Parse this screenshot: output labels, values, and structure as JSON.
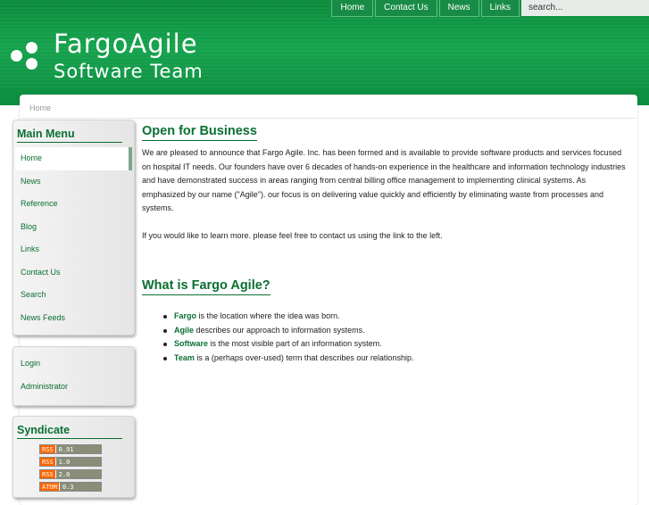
{
  "topnav": {
    "items": [
      "Home",
      "Contact Us",
      "News",
      "Links"
    ],
    "search_placeholder": "search..."
  },
  "site": {
    "title": "FargoAgile",
    "subtitle": "Software Team"
  },
  "breadcrumb": "Home",
  "main_menu": {
    "title": "Main Menu",
    "items": [
      "Home",
      "News",
      "Reference",
      "Blog",
      "Links",
      "Contact Us",
      "Search",
      "News Feeds"
    ]
  },
  "user_menu": {
    "items": [
      "Login",
      "Administrator"
    ]
  },
  "syndicate": {
    "title": "Syndicate",
    "feeds": [
      {
        "badge": "RSS",
        "version": "0.91"
      },
      {
        "badge": "RSS",
        "version": "1.0"
      },
      {
        "badge": "RSS",
        "version": "2.0"
      },
      {
        "badge": "ATOM",
        "version": "0.3"
      }
    ]
  },
  "article1": {
    "heading": "Open for Business",
    "p1": "We are pleased to announce that Fargo Agile. Inc. has been formed and is available to provide software products and services focused on hospital IT needs. Our founders have over 6 decades of hands-on experience in the healthcare and information technology industries and have demonstrated success in areas ranging from central billing office management to implementing clinical systems. As emphasized by our name (\"Agile\"). our focus is on delivering value quickly and efficiently by eliminating waste from processes and systems.",
    "p2": "If you would like to learn more. please feel free to contact us using the link to the left."
  },
  "article2": {
    "heading": "What is Fargo Agile?",
    "items": [
      {
        "term": "Fargo",
        "text": " is the location where the idea was born."
      },
      {
        "term": "Agile",
        "text": " describes our approach to information systems."
      },
      {
        "term": "Software",
        "text": " is the most visible part of an information system."
      },
      {
        "term": "Team",
        "text": " is a (perhaps over-used) term that describes our relationship."
      }
    ]
  }
}
